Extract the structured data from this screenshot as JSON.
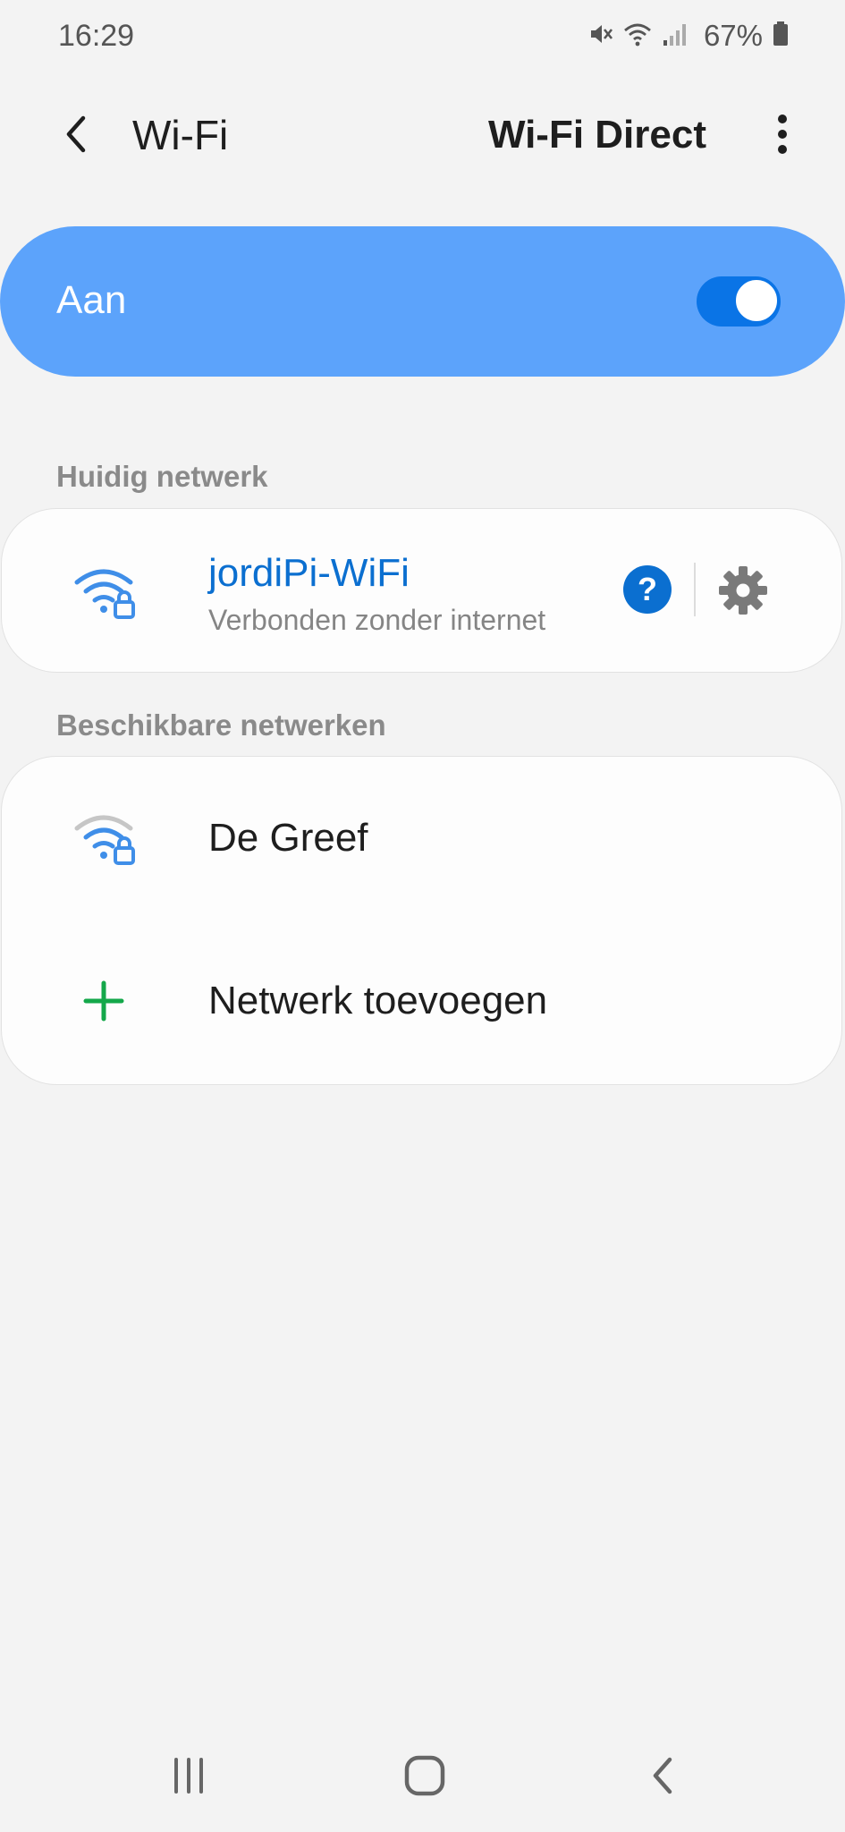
{
  "status_bar": {
    "time": "16:29",
    "battery": "67%",
    "icons": [
      "mute-icon",
      "wifi-icon",
      "signal-icon",
      "battery-icon"
    ]
  },
  "header": {
    "title": "Wi-Fi",
    "wifi_direct_label": "Wi-Fi Direct",
    "back_icon": "chevron-left-icon",
    "more_icon": "more-vertical-icon"
  },
  "master_switch": {
    "label": "Aan",
    "on": true
  },
  "current_network": {
    "heading": "Huidig netwerk",
    "name": "jordiPi-WiFi",
    "status": "Verbonden zonder internet",
    "help_label": "?"
  },
  "available_networks": {
    "heading": "Beschikbare netwerken",
    "items": [
      {
        "name": "De Greef",
        "icon": "wifi-lock-icon"
      }
    ],
    "add_label": "Netwerk toevoegen"
  },
  "colors": {
    "accent": "#5ca3fb",
    "toggle": "#0a74e6",
    "link": "#0b6fd0",
    "add": "#14a84a"
  },
  "nav_bar": {
    "icons": [
      "recent-apps-icon",
      "home-icon",
      "back-icon"
    ]
  }
}
